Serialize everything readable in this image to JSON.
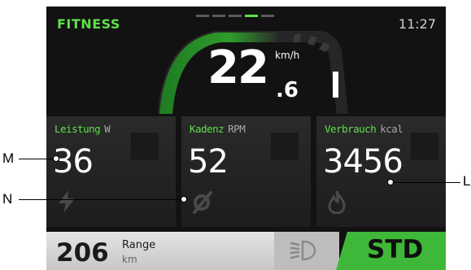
{
  "header": {
    "mode": "FITNESS",
    "clock": "11:27",
    "page_indicator": {
      "pages": 5,
      "active": 4
    }
  },
  "speed": {
    "integer": "22",
    "decimal": ".6",
    "unit": "km/h"
  },
  "tiles": [
    {
      "label": "Leistung",
      "unit": "W",
      "value": "36",
      "icon": "lightning-icon"
    },
    {
      "label": "Kadenz",
      "unit": "RPM",
      "value": "52",
      "icon": "cadence-icon"
    },
    {
      "label": "Verbrauch",
      "unit": "kcal",
      "value": "3456",
      "icon": "flame-icon"
    }
  ],
  "bottom": {
    "range_value": "206",
    "range_label": "Range",
    "range_unit": "km",
    "light_icon": "headlight-icon",
    "mode_button": "STD"
  },
  "annotations": {
    "m": "M",
    "n": "N",
    "l": "L"
  },
  "colors": {
    "accent": "#5ee04a",
    "mode_button": "#3fb83a",
    "background": "#121212"
  }
}
